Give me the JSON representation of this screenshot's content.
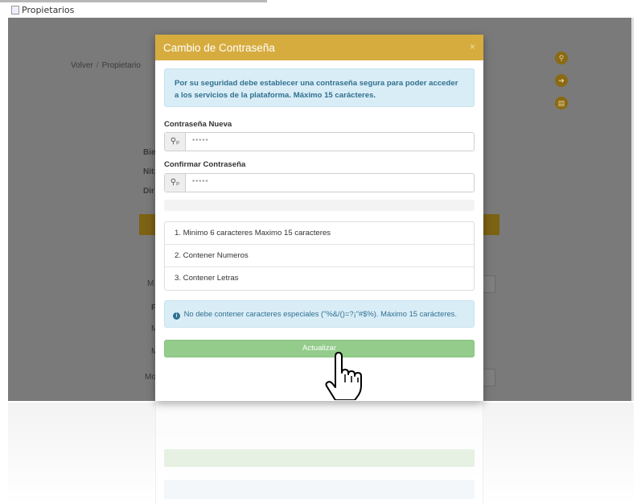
{
  "page": {
    "image_alt": "Propietarios"
  },
  "background": {
    "breadcrumb": {
      "back": "Volver",
      "separator": "/",
      "current": "Propietario"
    },
    "fragments": {
      "bie": "Bie",
      "nit": "Nit:",
      "dir": "Dir",
      "m1": "M",
      "f": "F",
      "m2": "M",
      "m3": "M",
      "mo": "Mo"
    }
  },
  "modal": {
    "title": "Cambio de Contraseña",
    "close": "×",
    "info": "Por su seguridad debe establecer una contraseña segura para poder acceder a los servicios de la plataforma. Máximo 15 carácteres.",
    "new_password": {
      "label": "Contraseña Nueva",
      "value": "*****",
      "icon": "key-icon"
    },
    "confirm_password": {
      "label": "Confirmar Contraseña",
      "value": "*****",
      "icon": "key-icon"
    },
    "requirements": [
      "1. Minimo 6 caracteres Maximo 15 caracteres",
      "2. Contener Numeros",
      "3. Contener Letras"
    ],
    "warning": "No debe contener caracteres especiales (\"%&/()=?¡\"#$%). Máximo 15 carácteres.",
    "submit_label": "Actualizar"
  },
  "colors": {
    "header": "#d6ac3e",
    "info_bg": "#d9edf7",
    "info_text": "#31708f",
    "button": "#93cc8b"
  }
}
